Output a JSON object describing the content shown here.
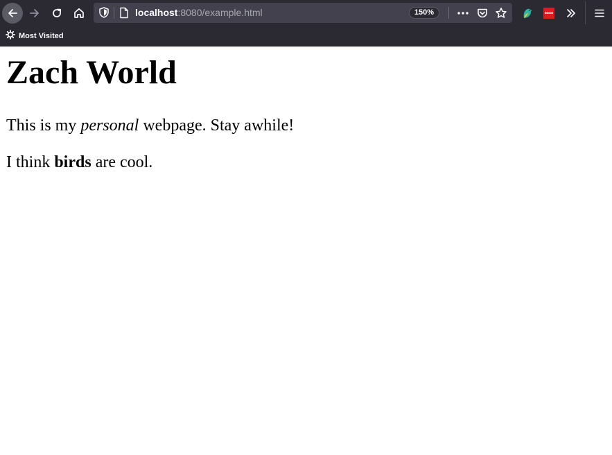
{
  "browser": {
    "url_host": "localhost",
    "url_rest": ":8080/example.html",
    "zoom": "150%",
    "bookmarks": [
      {
        "label": "Most Visited"
      }
    ],
    "extension_colors": {
      "ext1": "#2bb5a3",
      "ext2": "#e01b1b"
    }
  },
  "page": {
    "title": "Zach World",
    "paragraph1": {
      "before": "This is my ",
      "emphasis": "personal",
      "after": " webpage. Stay awhile!"
    },
    "paragraph2": {
      "before": "I think ",
      "strong": "birds",
      "after": " are cool."
    }
  }
}
